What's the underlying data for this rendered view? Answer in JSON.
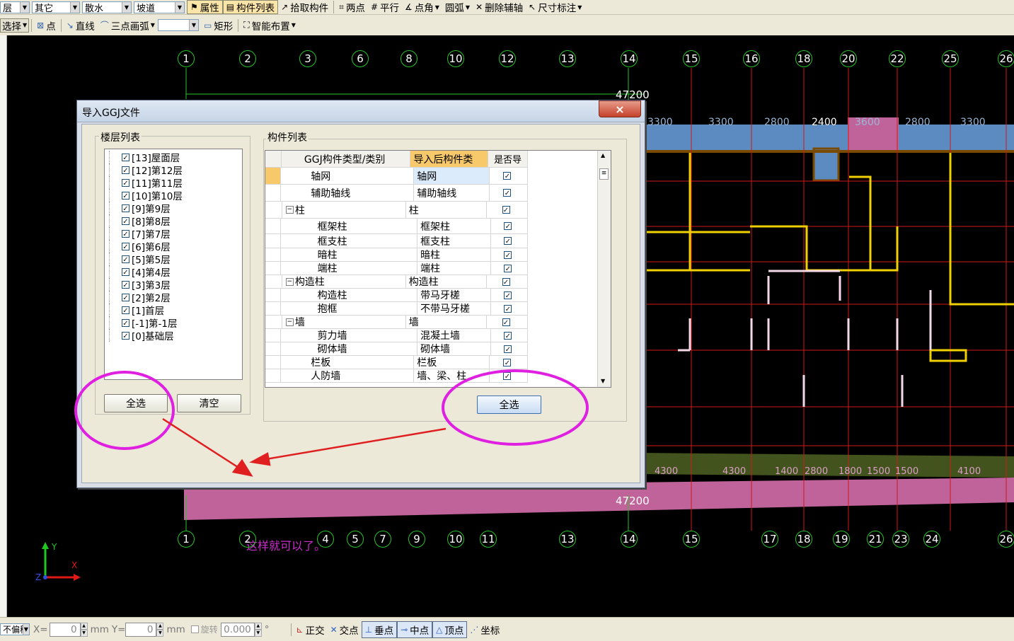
{
  "toolbar1": {
    "combo1": "层",
    "combo2": "其它",
    "combo3": "散水",
    "combo4": "坡道",
    "btn_property": "属性",
    "btn_component_list": "构件列表",
    "btn_pick": "拾取构件",
    "btn_two_point": "两点",
    "btn_parallel": "平行",
    "btn_point_angle": "点角",
    "btn_arc": "圆弧",
    "btn_delete_axis": "删除辅轴",
    "btn_dim": "尺寸标注"
  },
  "toolbar2": {
    "select": "选择",
    "point": "点",
    "line": "直线",
    "arc3": "三点画弧",
    "rect": "矩形",
    "smart": "智能布置"
  },
  "canvas": {
    "top_axes": [
      "1",
      "2",
      "3",
      "6",
      "8",
      "10",
      "12",
      "13",
      "14",
      "15",
      "16",
      "18",
      "20",
      "22",
      "25",
      "26"
    ],
    "bottom_axes": [
      "1",
      "2",
      "4",
      "5",
      "7",
      "9",
      "10",
      "11",
      "13",
      "14",
      "15",
      "17",
      "18",
      "19",
      "21",
      "23",
      "24",
      "26"
    ],
    "dim_top_total": "47200",
    "dim_bottom_total": "47200",
    "dim_segments_top": [
      "3300",
      "3300",
      "2800",
      "2400",
      "3600",
      "2800",
      "3300"
    ],
    "dim_segments_bottom": [
      "4300",
      "4300",
      "1400",
      "2800",
      "1800",
      "1500",
      "1500",
      "4100"
    ],
    "note": "这样就可以了。",
    "ucs_y": "Y",
    "ucs_x": "X",
    "ucs_z": "Z"
  },
  "dialog": {
    "title": "导入GGJ文件",
    "close": "×",
    "floor_group": "楼层列表",
    "floors": [
      "[13]屋面层",
      "[12]第12层",
      "[11]第11层",
      "[10]第10层",
      "[9]第9层",
      "[8]第8层",
      "[7]第7层",
      "[6]第6层",
      "[5]第5层",
      "[4]第4层",
      "[3]第3层",
      "[2]第2层",
      "[1]首层",
      "[-1]第-1层",
      "[0]基础层"
    ],
    "check": "✓",
    "btn_select_all_left": "全选",
    "btn_clear": "清空",
    "component_group": "构件列表",
    "columns": [
      "GGJ构件类型/类别",
      "导入后构件类",
      "是否导"
    ],
    "rows": [
      {
        "name": "轴网",
        "target": "轴网"
      },
      {
        "name": "辅助轴线",
        "target": "辅助轴线"
      },
      {
        "name": "柱",
        "target": "柱"
      },
      {
        "name": "框架柱",
        "target": "框架柱"
      },
      {
        "name": "框支柱",
        "target": "框支柱"
      },
      {
        "name": "暗柱",
        "target": "暗柱"
      },
      {
        "name": "端柱",
        "target": "端柱"
      },
      {
        "name": "构造柱",
        "target": "构造柱"
      },
      {
        "name": "构造柱",
        "target": "带马牙槎"
      },
      {
        "name": "抱框",
        "target": "不带马牙槎"
      },
      {
        "name": "墙",
        "target": "墙"
      },
      {
        "name": "剪力墙",
        "target": "混凝土墙"
      },
      {
        "name": "砌体墙",
        "target": "砌体墙"
      },
      {
        "name": "栏板",
        "target": "栏板"
      },
      {
        "name": "人防墙",
        "target": "墙、梁、柱"
      }
    ],
    "btn_select_all_right": "全选"
  },
  "status": {
    "offset": "不偏移",
    "x_label": "X=",
    "x_value": "0",
    "mm1": "mm",
    "y_label": "Y=",
    "y_value": "0",
    "mm2": "mm",
    "rotate": "旋转",
    "rotate_value": "0.000",
    "degree": "°",
    "ortho": "正交",
    "intersection": "交点",
    "perpendicular": "垂点",
    "midpoint": "中点",
    "vertex": "顶点",
    "coordinate": "坐标"
  },
  "colors": {
    "canvas_bg": "#000000",
    "axis_bubble": "#27c427",
    "axis_line": "#d01818",
    "annotation": "#e020e0",
    "wall_yellow": "#f0d000",
    "slab_pink": "#c0639a",
    "slab_blue": "#5b8bc0"
  }
}
